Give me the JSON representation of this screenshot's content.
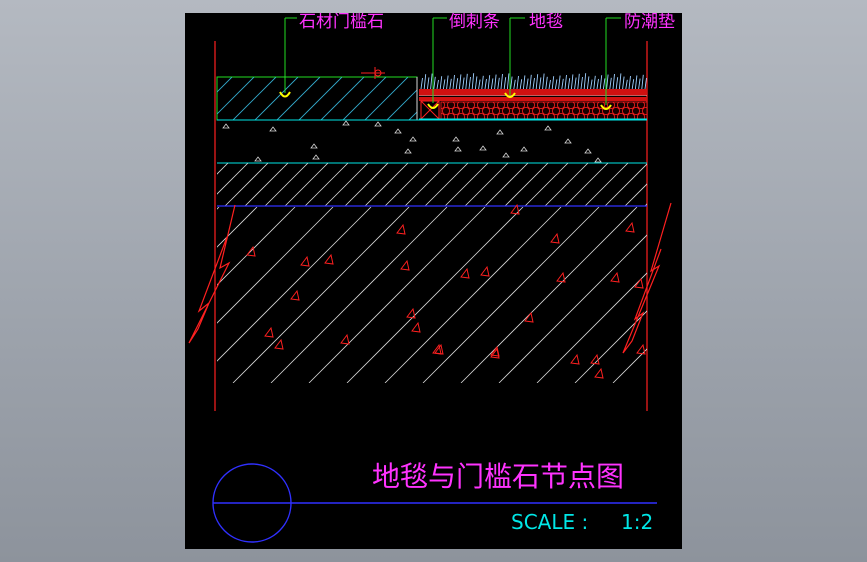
{
  "viewport_background": "gray-gradient",
  "drawing": {
    "background": "#000000",
    "callouts": [
      {
        "label": "石材门槛石"
      },
      {
        "label": "倒刺条"
      },
      {
        "label": "地毯"
      },
      {
        "label": "防潮垫"
      }
    ],
    "title": "地毯与门槛石节点图",
    "scale_label": "SCALE :",
    "scale_value": "1:2"
  },
  "colors": {
    "label_magenta": "#ff33ff",
    "leader_green": "#22dd22",
    "marker_yellow": "#ffff00",
    "layer_cyan": "#00e6e6",
    "break_red": "#ff2020",
    "hatch_white": "#d8d8d8",
    "blue_line": "#3030ff",
    "scale_cyan": "#00e6e6"
  },
  "icons": {
    "section_circle": "detail-circle-icon",
    "break_lines": "break-line-icon"
  }
}
